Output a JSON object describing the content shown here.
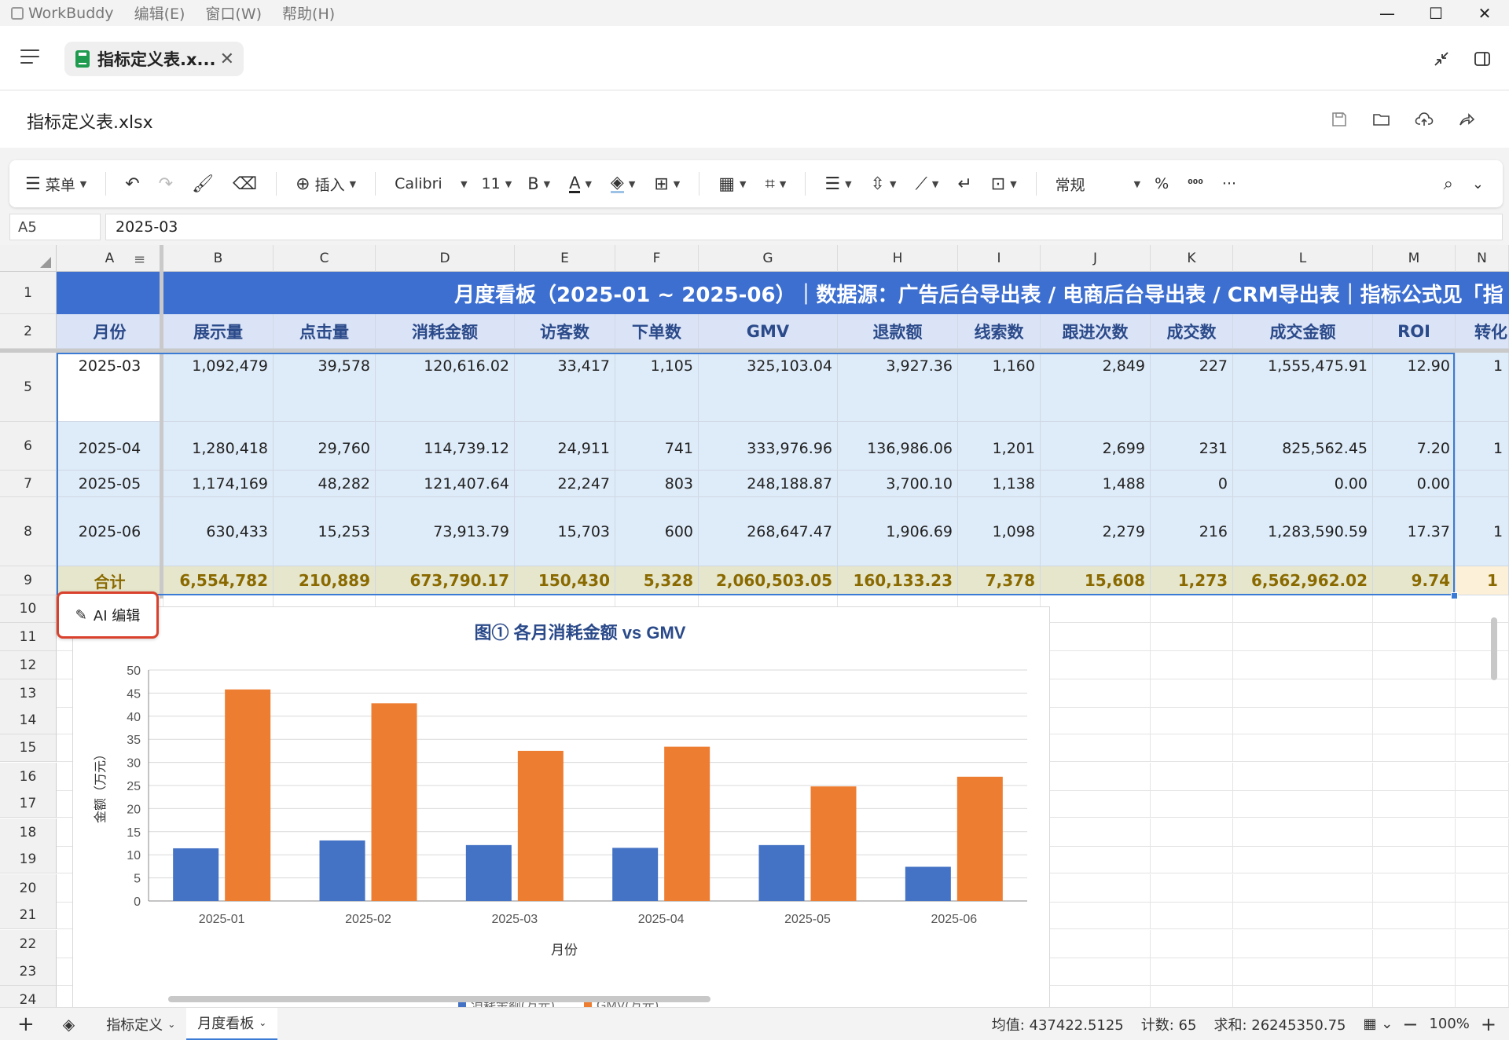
{
  "window": {
    "app_name": "WorkBuddy",
    "menus": [
      "编辑(E)",
      "窗口(W)",
      "帮助(H)"
    ],
    "controls": [
      "—",
      "☐",
      "✕"
    ]
  },
  "tab": {
    "label": "指标定义表.x...",
    "close": "✕"
  },
  "file": {
    "title": "指标定义表.xlsx"
  },
  "toolbar": {
    "menu_label": "菜单",
    "insert_label": "插入",
    "font_name": "Calibri",
    "font_size": "11",
    "bold": "B",
    "font_color": "A",
    "number_format": "常规",
    "percent": "%",
    "more": "···"
  },
  "formula_bar": {
    "cell_ref": "A5",
    "value": "2025-03"
  },
  "columns": [
    "A",
    "B",
    "C",
    "D",
    "E",
    "F",
    "G",
    "H",
    "I",
    "J",
    "K",
    "L",
    "M",
    "N"
  ],
  "row_numbers": [
    "1",
    "2",
    "5",
    "6",
    "7",
    "8",
    "9",
    "10",
    "11",
    "12",
    "13",
    "14",
    "15",
    "16",
    "17",
    "18",
    "19",
    "20",
    "21",
    "22",
    "23",
    "24"
  ],
  "banner": "月度看板（2025-01 ~ 2025-06）｜数据源：广告后台导出表 / 电商后台导出表 / CRM导出表｜指标公式见「指",
  "headers": [
    "月份",
    "展示量",
    "点击量",
    "消耗金额",
    "访客数",
    "下单数",
    "GMV",
    "退款额",
    "线索数",
    "跟进次数",
    "成交数",
    "成交金额",
    "ROI",
    "转化"
  ],
  "rows": [
    [
      "2025-03",
      "1,092,479",
      "39,578",
      "120,616.02",
      "33,417",
      "1,105",
      "325,103.04",
      "3,927.36",
      "1,160",
      "2,849",
      "227",
      "1,555,475.91",
      "12.90",
      "1"
    ],
    [
      "2025-04",
      "1,280,418",
      "29,760",
      "114,739.12",
      "24,911",
      "741",
      "333,976.96",
      "136,986.06",
      "1,201",
      "2,699",
      "231",
      "825,562.45",
      "7.20",
      "1"
    ],
    [
      "2025-05",
      "1,174,169",
      "48,282",
      "121,407.64",
      "22,247",
      "803",
      "248,188.87",
      "3,700.10",
      "1,138",
      "1,488",
      "0",
      "0.00",
      "0.00",
      ""
    ],
    [
      "2025-06",
      "630,433",
      "15,253",
      "73,913.79",
      "15,703",
      "600",
      "268,647.47",
      "1,906.69",
      "1,098",
      "2,279",
      "216",
      "1,283,590.59",
      "17.37",
      "1"
    ]
  ],
  "totals": [
    "合计",
    "6,554,782",
    "210,889",
    "673,790.17",
    "150,430",
    "5,328",
    "2,060,503.05",
    "160,133.23",
    "7,378",
    "15,608",
    "1,273",
    "6,562,962.02",
    "9.74",
    "1"
  ],
  "ai_edit_label": "AI 编辑",
  "chart_data": {
    "type": "bar",
    "title": "图① 各月消耗金额 vs GMV",
    "xlabel": "月份",
    "ylabel": "金额（万元）",
    "categories": [
      "2025-01",
      "2025-02",
      "2025-03",
      "2025-04",
      "2025-05",
      "2025-06"
    ],
    "ylim": [
      0,
      50
    ],
    "yticks": [
      0,
      5,
      10,
      15,
      20,
      25,
      30,
      35,
      40,
      45,
      50
    ],
    "grid": true,
    "legend": "bottom",
    "series": [
      {
        "name": "消耗金额(万元)",
        "color": "#4472c4",
        "values": [
          11.4,
          13.1,
          12.1,
          11.5,
          12.1,
          7.4
        ]
      },
      {
        "name": "GMV(万元)",
        "color": "#ed7d31",
        "values": [
          45.8,
          42.8,
          32.5,
          33.4,
          24.8,
          26.9
        ]
      }
    ]
  },
  "sheets": [
    {
      "label": "指标定义",
      "active": false
    },
    {
      "label": "月度看板",
      "active": true
    }
  ],
  "status": {
    "avg": "均值: 437422.5125",
    "count": "计数: 65",
    "sum": "求和: 26245350.75",
    "zoom": "100%"
  }
}
